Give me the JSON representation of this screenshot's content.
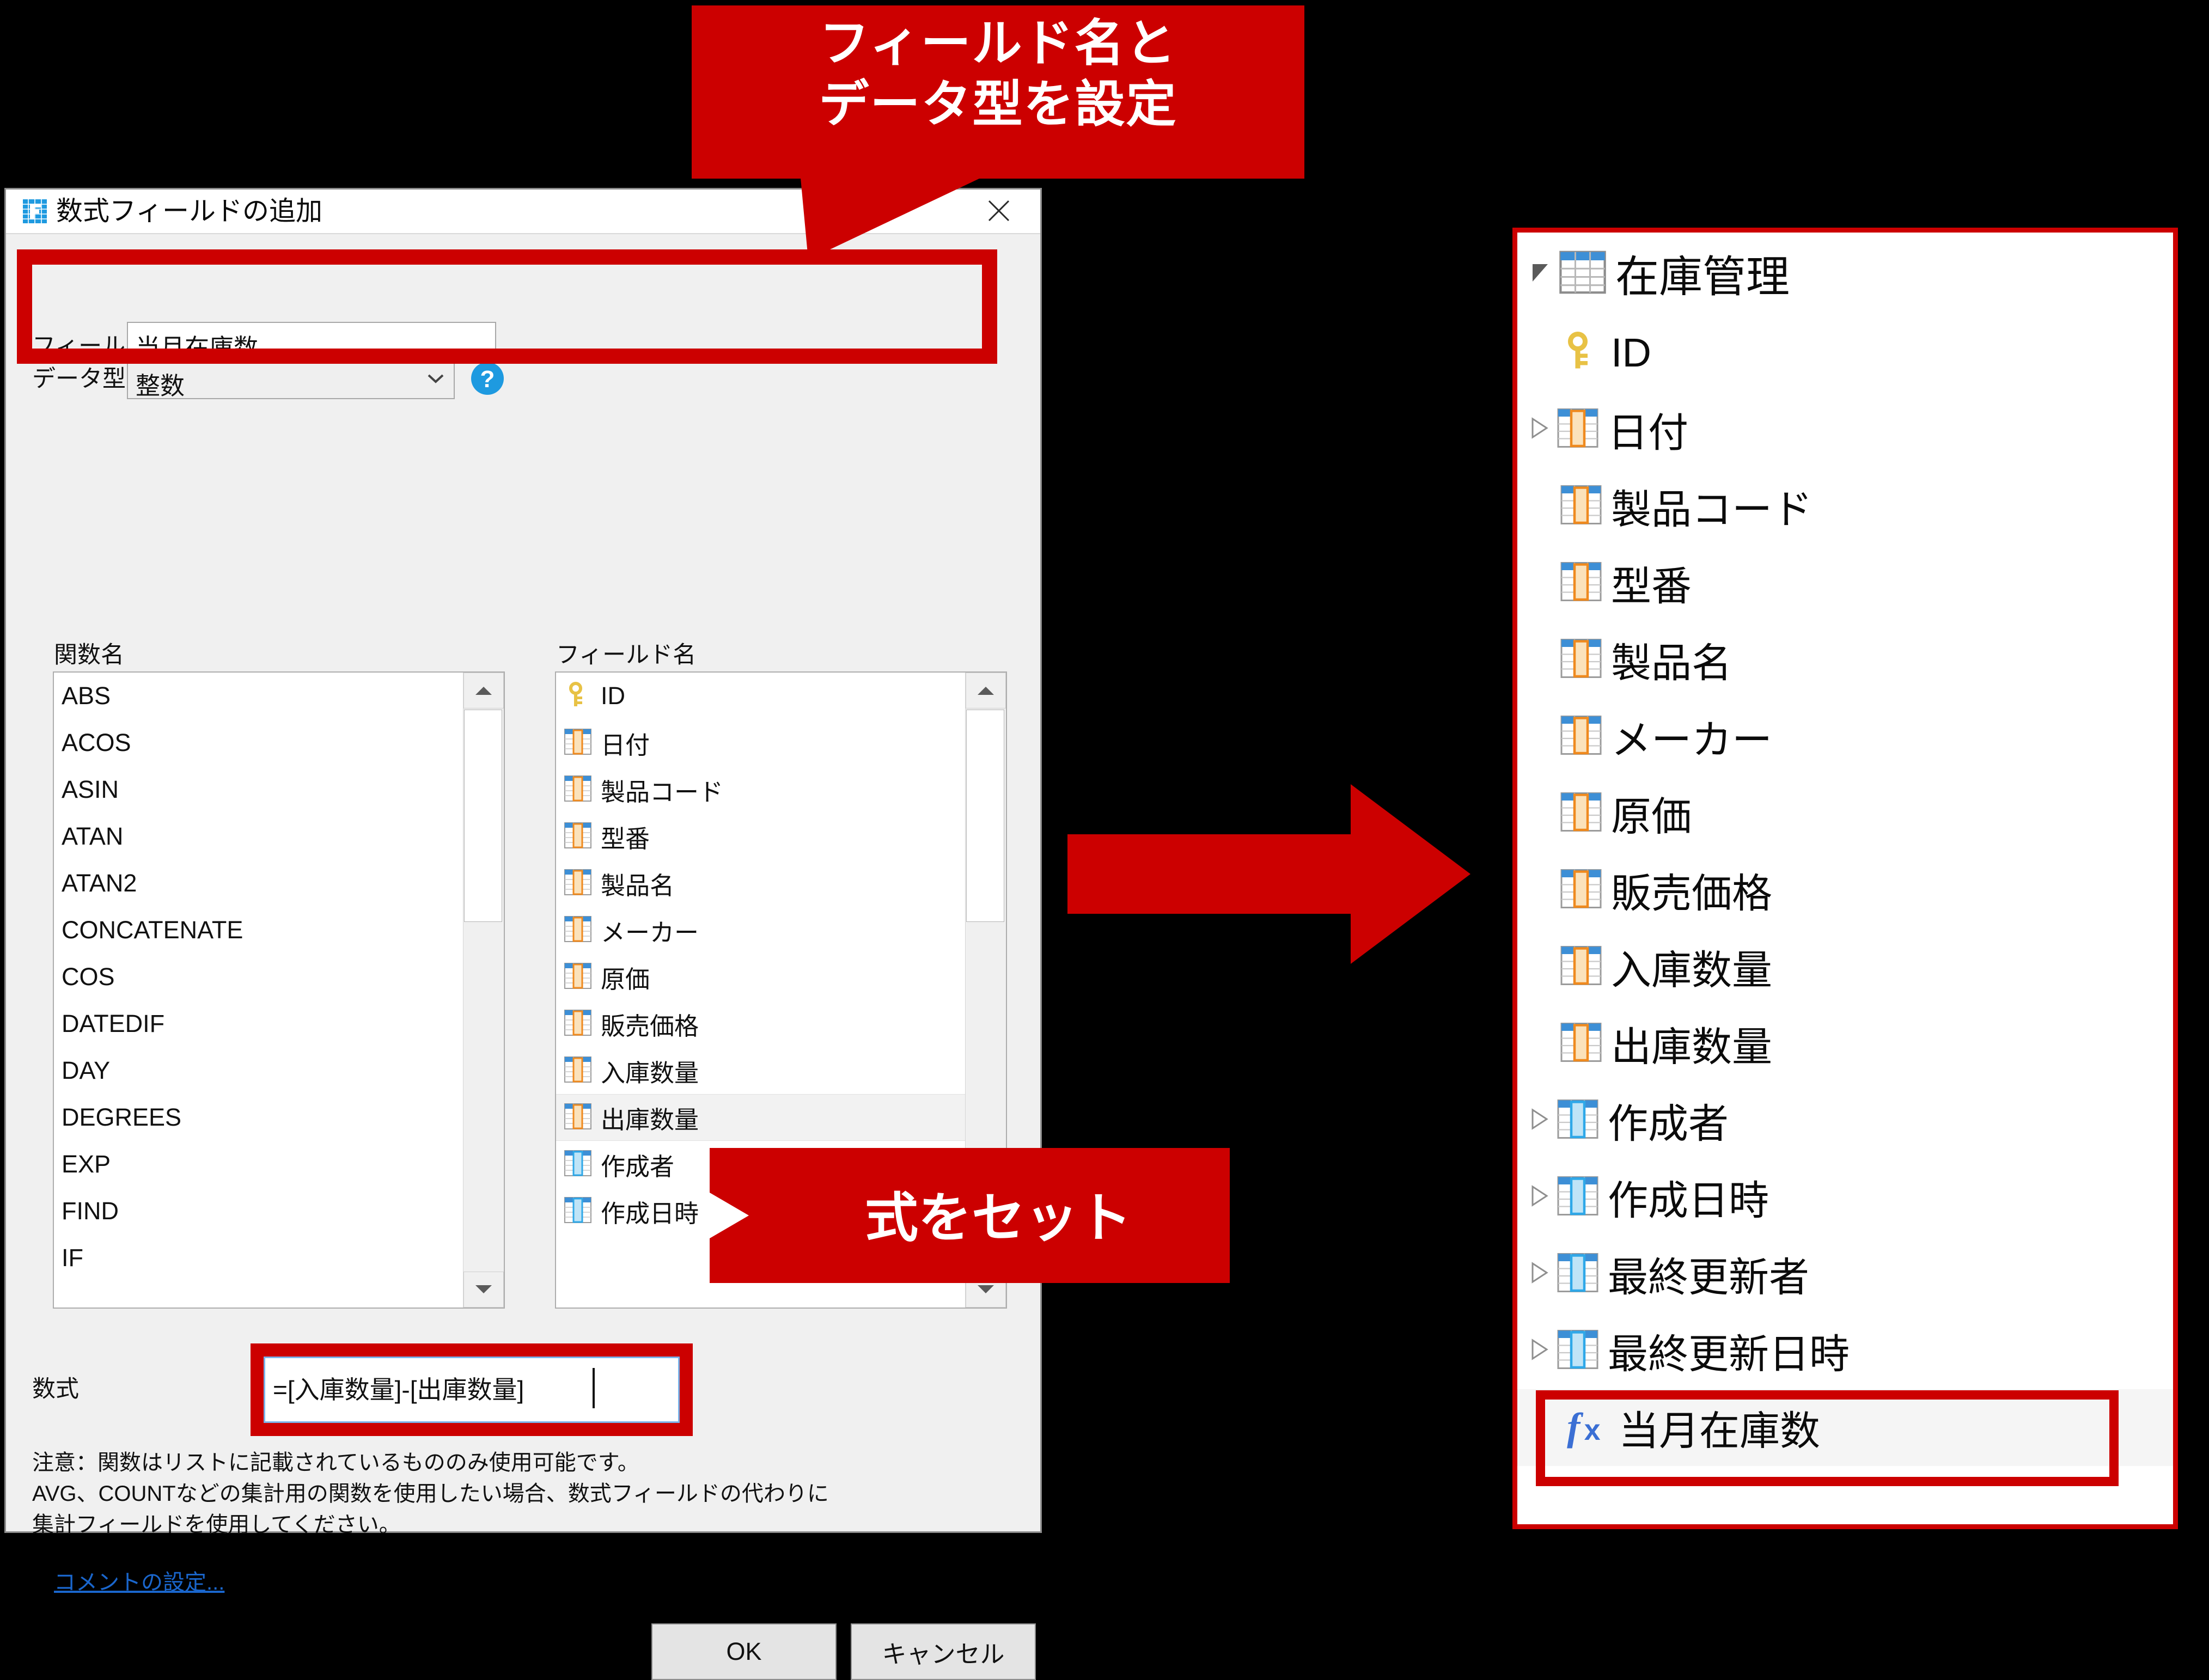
{
  "dialog": {
    "title": "数式フィールドの追加",
    "app_icon": "formula-field-icon",
    "close_icon": "close-icon",
    "field_name_label": "フィールド名：",
    "field_name_value": "当月在庫数",
    "data_type_label": "データ型：",
    "data_type_value": "整数",
    "help_icon": "help-icon",
    "function_header": "関数名",
    "field_header": "フィールド名",
    "formula_label": "数式",
    "formula_value": "=[入庫数量]-[出庫数量]",
    "note_line1": "注意：関数はリストに記載されているもののみ使用可能です。",
    "note_line2": "AVG、COUNTなどの集計用の関数を使用したい場合、数式フィールドの代わりに",
    "note_line3": "集計フィールドを使用してください。",
    "comment_link": "コメントの設定...",
    "ok_label": "OK",
    "cancel_label": "キャンセル"
  },
  "function_list": [
    "ABS",
    "ACOS",
    "ASIN",
    "ATAN",
    "ATAN2",
    "CONCATENATE",
    "COS",
    "DATEDIF",
    "DAY",
    "DEGREES",
    "EXP",
    "FIND",
    "IF"
  ],
  "field_list": [
    {
      "label": "ID",
      "icon": "key-icon",
      "selected": false
    },
    {
      "label": "日付",
      "icon": "column-orange-icon",
      "selected": false
    },
    {
      "label": "製品コード",
      "icon": "column-orange-icon",
      "selected": false
    },
    {
      "label": "型番",
      "icon": "column-orange-icon",
      "selected": false
    },
    {
      "label": "製品名",
      "icon": "column-orange-icon",
      "selected": false
    },
    {
      "label": "メーカー",
      "icon": "column-orange-icon",
      "selected": false
    },
    {
      "label": "原価",
      "icon": "column-orange-icon",
      "selected": false
    },
    {
      "label": "販売価格",
      "icon": "column-orange-icon",
      "selected": false
    },
    {
      "label": "入庫数量",
      "icon": "column-orange-icon",
      "selected": false
    },
    {
      "label": "出庫数量",
      "icon": "column-orange-icon",
      "selected": true
    },
    {
      "label": "作成者",
      "icon": "column-blue-icon",
      "selected": false
    },
    {
      "label": "作成日時",
      "icon": "column-blue-icon",
      "selected": false
    }
  ],
  "callouts": {
    "top_line1": "フィールド名と",
    "top_line2": "データ型を設定",
    "set_formula": "式をセット",
    "arrow_icon": "right-arrow-icon",
    "accent_color": "#cc0000"
  },
  "tree": {
    "root": {
      "label": "在庫管理",
      "icon": "table-icon",
      "expander": "expanded"
    },
    "items": [
      {
        "label": "ID",
        "icon": "key-icon",
        "expander": "none"
      },
      {
        "label": "日付",
        "icon": "column-orange-icon",
        "expander": "collapsed"
      },
      {
        "label": "製品コード",
        "icon": "column-orange-icon",
        "expander": "none"
      },
      {
        "label": "型番",
        "icon": "column-orange-icon",
        "expander": "none"
      },
      {
        "label": "製品名",
        "icon": "column-orange-icon",
        "expander": "none"
      },
      {
        "label": "メーカー",
        "icon": "column-orange-icon",
        "expander": "none"
      },
      {
        "label": "原価",
        "icon": "column-orange-icon",
        "expander": "none"
      },
      {
        "label": "販売価格",
        "icon": "column-orange-icon",
        "expander": "none"
      },
      {
        "label": "入庫数量",
        "icon": "column-orange-icon",
        "expander": "none"
      },
      {
        "label": "出庫数量",
        "icon": "column-orange-icon",
        "expander": "none"
      },
      {
        "label": "作成者",
        "icon": "column-blue-icon",
        "expander": "collapsed"
      },
      {
        "label": "作成日時",
        "icon": "column-blue-icon",
        "expander": "collapsed"
      },
      {
        "label": "最終更新者",
        "icon": "column-blue-icon",
        "expander": "collapsed"
      },
      {
        "label": "最終更新日時",
        "icon": "column-blue-icon",
        "expander": "collapsed"
      }
    ],
    "formula_field": {
      "label": "当月在庫数",
      "icon": "fx-icon"
    }
  }
}
